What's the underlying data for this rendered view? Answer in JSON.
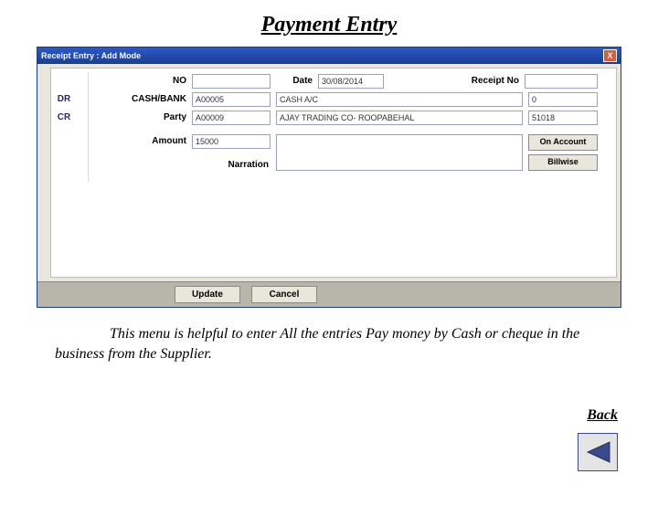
{
  "page": {
    "title": "Payment Entry",
    "caption": "This menu is helpful to enter All the entries Pay money by Cash or cheque in the business from the Supplier.",
    "back": "Back"
  },
  "win": {
    "title": "Receipt Entry : Add Mode",
    "close": "X"
  },
  "labels": {
    "no": "NO",
    "date": "Date",
    "receipt_no": "Receipt No",
    "dr": "DR",
    "cr": "CR",
    "cashbank": "CASH/BANK",
    "party": "Party",
    "amount": "Amount",
    "narration": "Narration"
  },
  "values": {
    "no": "",
    "date": "30/08/2014",
    "receipt_no": "",
    "cashbank_code": "A00005",
    "cashbank_name": "CASH A/C",
    "cashbank_bal": "0",
    "party_code": "A00009",
    "party_name": "AJAY TRADING CO- ROOPABEHAL",
    "party_bal": "51018",
    "amount": "15000",
    "narration": ""
  },
  "buttons": {
    "on_account": "On Account",
    "billwise": "Billwise",
    "update": "Update",
    "cancel": "Cancel"
  }
}
